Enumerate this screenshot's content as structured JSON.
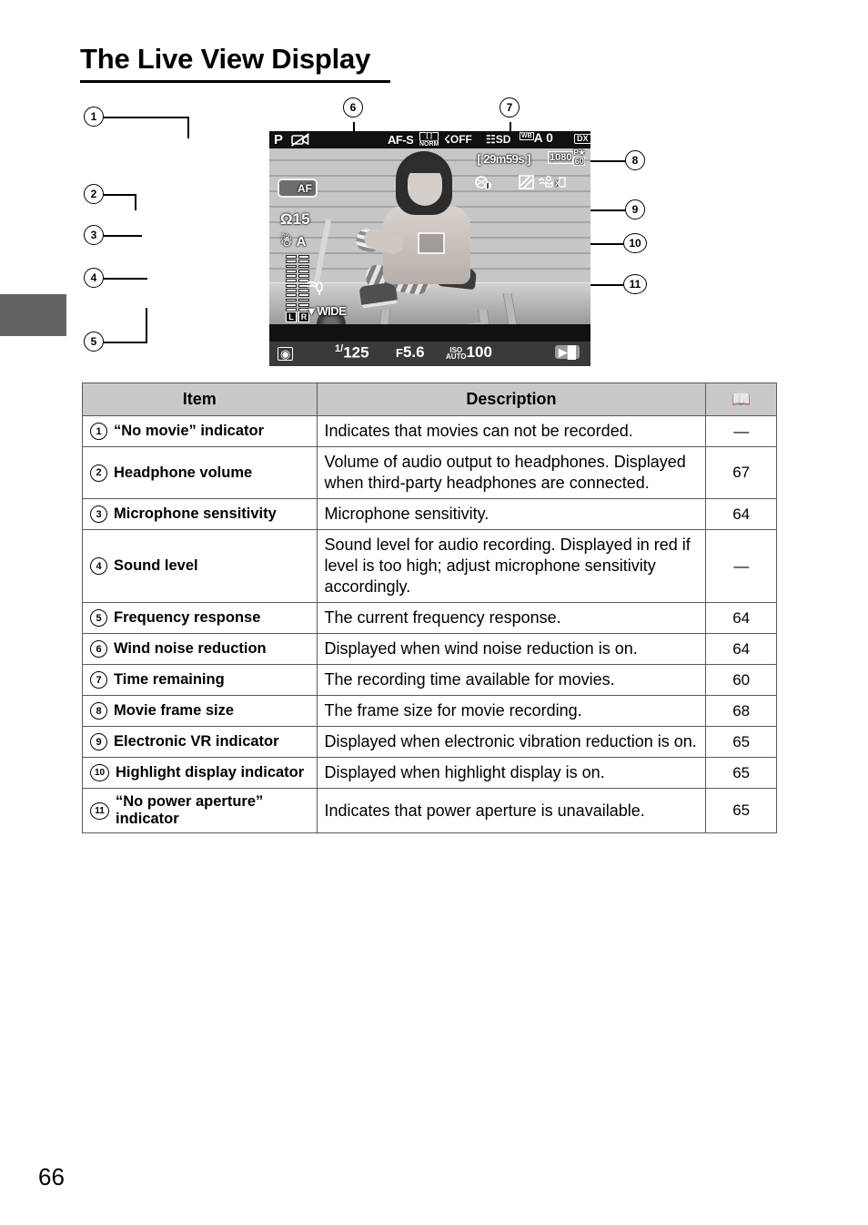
{
  "page": {
    "title": "The Live View Display",
    "folio": "66"
  },
  "figure": {
    "callouts": [
      {
        "id": "1",
        "label": "1"
      },
      {
        "id": "2",
        "label": "2"
      },
      {
        "id": "3",
        "label": "3"
      },
      {
        "id": "4",
        "label": "4"
      },
      {
        "id": "5",
        "label": "5"
      },
      {
        "id": "6",
        "label": "6"
      },
      {
        "id": "7",
        "label": "7"
      },
      {
        "id": "8",
        "label": "8"
      },
      {
        "id": "9",
        "label": "9"
      },
      {
        "id": "10",
        "label": "10"
      },
      {
        "id": "11",
        "label": "11"
      }
    ],
    "lcd": {
      "top_bar": {
        "exposure_mode": "P",
        "no_movie_icon": "no-movie-icon",
        "focus_mode": "AF-S",
        "af_area_mode": "NORM",
        "flash_mode": "OFF",
        "image_area_label": "SD",
        "white_balance_prefix": "WB",
        "white_balance_value": "A 0",
        "image_size": "DX"
      },
      "left": {
        "touch_af_label": "AF",
        "headphone_volume": "15",
        "microphone_sensitivity": "A",
        "sound_level_left": "L",
        "sound_level_right": "R",
        "frequency_response": "WIDE",
        "wind_noise_icon": "wind-noise-reduction-icon"
      },
      "right": {
        "time_remaining": "[ 29m59s ]",
        "frame_size_resolution": "1080",
        "frame_size_rate": "60",
        "frame_size_quality": "P★",
        "no_power_aperture_icon": "no-power-aperture-icon",
        "highlight_display_icon": "highlight-display-icon",
        "electronic_vr_icon": "electronic-vr-icon"
      },
      "bottom_bar": {
        "metering_icon": "matrix-metering-icon",
        "shutter_speed_numerator": "1/",
        "shutter_speed": "125",
        "aperture_prefix": "F",
        "aperture": "5.6",
        "iso_label_top": "ISO",
        "iso_label_bottom": "AUTO",
        "iso_value": "100",
        "movie_icon": "movie-mode-icon"
      }
    }
  },
  "table": {
    "headers": {
      "item": "Item",
      "description": "Description",
      "page": "book-icon"
    },
    "rows": [
      {
        "num": "1",
        "item": "“No movie” indicator",
        "description": "Indicates that movies can not be recorded.",
        "page": "—"
      },
      {
        "num": "2",
        "item": "Headphone volume",
        "description": "Volume of audio output to headphones. Displayed when third-party headphones are connected.",
        "page": "67"
      },
      {
        "num": "3",
        "item": "Microphone sensitivity",
        "description": "Microphone sensitivity.",
        "page": "64"
      },
      {
        "num": "4",
        "item": "Sound level",
        "description": "Sound level for audio recording. Displayed in red if level is too high; adjust microphone sensitivity accordingly.",
        "page": "—"
      },
      {
        "num": "5",
        "item": "Frequency response",
        "description": "The current frequency response.",
        "page": "64"
      },
      {
        "num": "6",
        "item": "Wind noise reduction",
        "description": "Displayed when wind noise reduction is on.",
        "page": "64"
      },
      {
        "num": "7",
        "item": "Time remaining",
        "description": "The recording time available for movies.",
        "page": "60"
      },
      {
        "num": "8",
        "item": "Movie frame size",
        "description": "The frame size for movie recording.",
        "page": "68"
      },
      {
        "num": "9",
        "item": "Electronic VR indicator",
        "description": "Displayed when electronic vibration reduction is on.",
        "page": "65"
      },
      {
        "num": "10",
        "item": "Highlight display indicator",
        "description": "Displayed when highlight display is on.",
        "page": "65"
      },
      {
        "num": "11",
        "item": "“No power aperture” indicator",
        "description": "Indicates that power aperture is unavailable.",
        "page": "65"
      }
    ]
  }
}
